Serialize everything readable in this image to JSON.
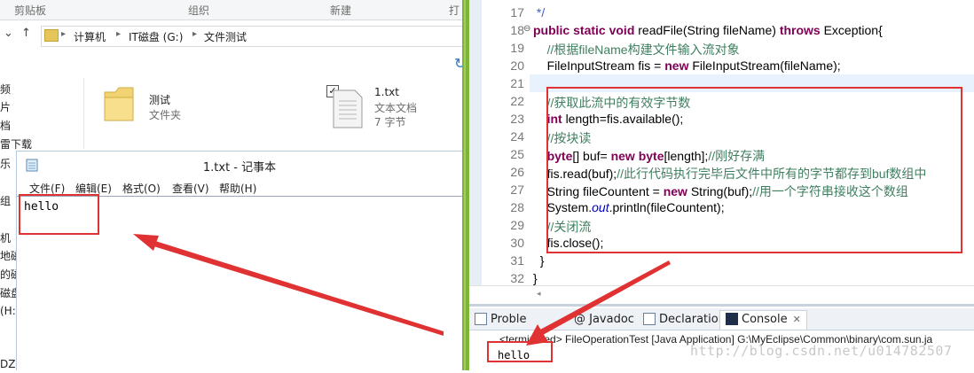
{
  "explorer": {
    "ribbon_groups": [
      "剪贴板",
      "组织",
      "新建",
      "打"
    ],
    "breadcrumbs": [
      "计算机",
      "IT磁盘 (G:)",
      "文件测试"
    ],
    "nav_items": [
      "频",
      "片",
      "档",
      "雷下载",
      "乐",
      "组",
      "机",
      "地磁",
      "的磁",
      "磁盘",
      "(H:",
      "DZ"
    ],
    "files": [
      {
        "name": "测试",
        "type": "文件夹"
      },
      {
        "name": "1.txt",
        "type": "文本文档",
        "size": "7 字节"
      }
    ]
  },
  "notepad": {
    "title": "1.txt - 记事本",
    "menu": [
      "文件(F)",
      "编辑(E)",
      "格式(O)",
      "查看(V)",
      "帮助(H)"
    ],
    "content": "hello"
  },
  "editor": {
    "lines": [
      {
        "n": "17",
        "t": " */"
      },
      {
        "n": "18",
        "t": "public static void readFile(String fileName) throws Exception{"
      },
      {
        "n": "19",
        "t": "    //根据fileName构建文件输入流对象"
      },
      {
        "n": "20",
        "t": "    FileInputStream fis = new FileInputStream(fileName);"
      },
      {
        "n": "21",
        "t": ""
      },
      {
        "n": "22",
        "t": "    //获取此流中的有效字节数"
      },
      {
        "n": "23",
        "t": "    int length=fis.available();"
      },
      {
        "n": "24",
        "t": "    //按块读"
      },
      {
        "n": "25",
        "t": "    byte[] buf= new byte[length];//刚好存满"
      },
      {
        "n": "26",
        "t": "    fis.read(buf);//此行代码执行完毕后文件中所有的字节都存到buf数组中"
      },
      {
        "n": "27",
        "t": "    String fileCountent = new String(buf);//用一个字符串接收这个数组"
      },
      {
        "n": "28",
        "t": "    System.out.println(fileCountent);"
      },
      {
        "n": "29",
        "t": "    //关闭流"
      },
      {
        "n": "30",
        "t": "    fis.close();"
      },
      {
        "n": "31",
        "t": "  }"
      },
      {
        "n": "32",
        "t": "}"
      }
    ]
  },
  "console": {
    "tabs": [
      "Proble",
      "@ Javadoc",
      "Declaration",
      "Console"
    ],
    "status": "<terminated> FileOperationTest [Java Application] G:\\MyEclipse\\Common\\binary\\com.sun.ja",
    "output": "hello"
  },
  "watermark": "http://blog.csdn.net/u014782507",
  "colors": {
    "annotation_red": "#e03232",
    "separator_green": "#7fb43a",
    "keyword": "#7f0055",
    "comment": "#3f7f5f"
  }
}
